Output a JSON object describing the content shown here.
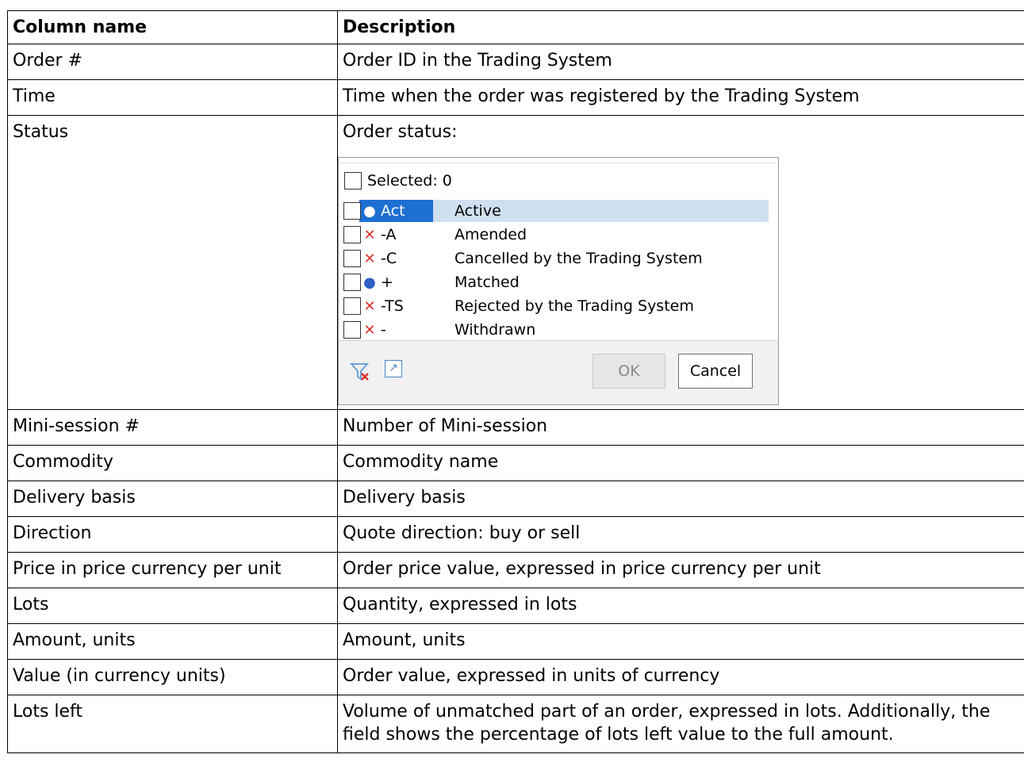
{
  "table": {
    "headers": {
      "name": "Column name",
      "description": "Description"
    },
    "rows": [
      {
        "name": "Order #",
        "description": "Order ID in the Trading System"
      },
      {
        "name": "Time",
        "description": "Time when the order was registered by the Trading System"
      },
      {
        "name": "Status",
        "description": "Order status:"
      },
      {
        "name": "Mini-session #",
        "description": "Number of Mini-session"
      },
      {
        "name": "Commodity",
        "description": "Commodity name"
      },
      {
        "name": "Delivery basis",
        "description": "Delivery basis"
      },
      {
        "name": "Direction",
        "description": "Quote direction: buy or sell"
      },
      {
        "name": "Price in price currency per unit",
        "description": "Order price value, expressed in price currency per unit"
      },
      {
        "name": "Lots",
        "description": "Quantity, expressed in lots"
      },
      {
        "name": "Amount, units",
        "description": "Amount, units"
      },
      {
        "name": "Value (in currency units)",
        "description": "Order value, expressed in units of currency"
      },
      {
        "name": "Lots left",
        "description": "Volume of unmatched part of an order, expressed in lots. Additionally, the field shows the percentage of lots left value to the full amount."
      }
    ]
  },
  "status_filter": {
    "select_all_label": "Selected: 0",
    "items": [
      {
        "code": "Act",
        "label": "Active",
        "icon": "white-dot-icon",
        "highlighted": true
      },
      {
        "code": "-A",
        "label": "Amended",
        "icon": "red-x-icon",
        "highlighted": false
      },
      {
        "code": "-C",
        "label": "Cancelled by the Trading System",
        "icon": "red-x-icon",
        "highlighted": false
      },
      {
        "code": "+",
        "label": "Matched",
        "icon": "blue-dot-icon",
        "highlighted": false
      },
      {
        "code": "-TS",
        "label": "Rejected by the Trading System",
        "icon": "red-x-icon",
        "highlighted": false
      },
      {
        "code": "-",
        "label": "Withdrawn",
        "icon": "red-x-icon",
        "highlighted": false
      }
    ],
    "ok_label": "OK",
    "cancel_label": "Cancel",
    "colors": {
      "highlight": "#cfe0f0",
      "selected_code": "#1e6fd3",
      "red_x": "#e0312e",
      "matched_dot": "#2d5fc6"
    }
  }
}
